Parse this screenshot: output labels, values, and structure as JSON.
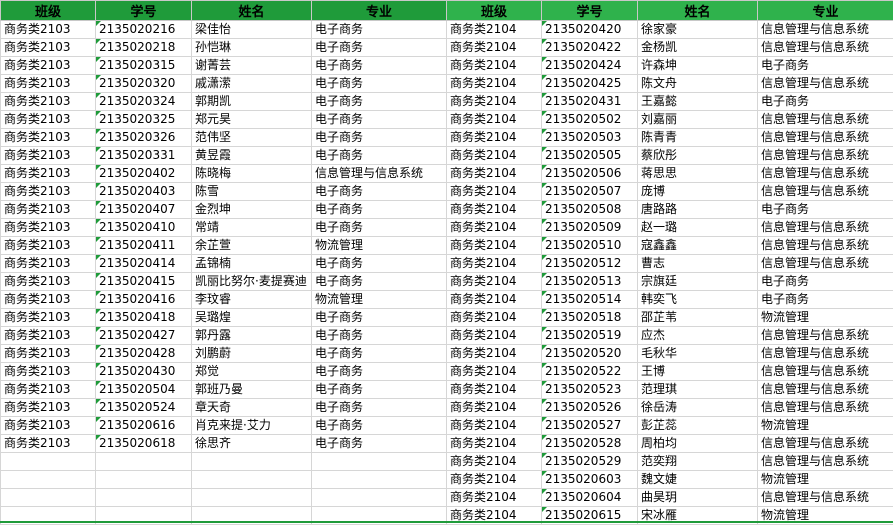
{
  "colors": {
    "header_left": "#1f9b3a",
    "header_right": "#2fb24c",
    "marker": "#1f9b3a"
  },
  "headers": [
    "班级",
    "学号",
    "姓名",
    "专业",
    "班级",
    "学号",
    "姓名",
    "专业"
  ],
  "left_rows": [
    [
      "商务类2103",
      "2135020216",
      "梁佳怡",
      "电子商务"
    ],
    [
      "商务类2103",
      "2135020218",
      "孙恺琳",
      "电子商务"
    ],
    [
      "商务类2103",
      "2135020315",
      "谢菁芸",
      "电子商务"
    ],
    [
      "商务类2103",
      "2135020320",
      "戚潇潆",
      "电子商务"
    ],
    [
      "商务类2103",
      "2135020324",
      "郭期凯",
      "电子商务"
    ],
    [
      "商务类2103",
      "2135020325",
      "郑元昊",
      "电子商务"
    ],
    [
      "商务类2103",
      "2135020326",
      "范伟坚",
      "电子商务"
    ],
    [
      "商务类2103",
      "2135020331",
      "黄昱霞",
      "电子商务"
    ],
    [
      "商务类2103",
      "2135020402",
      "陈晓梅",
      "信息管理与信息系统"
    ],
    [
      "商务类2103",
      "2135020403",
      "陈雪",
      "电子商务"
    ],
    [
      "商务类2103",
      "2135020407",
      "金烈坤",
      "电子商务"
    ],
    [
      "商务类2103",
      "2135020410",
      "常靖",
      "电子商务"
    ],
    [
      "商务类2103",
      "2135020411",
      "余芷萱",
      "物流管理"
    ],
    [
      "商务类2103",
      "2135020414",
      "孟锦楠",
      "电子商务"
    ],
    [
      "商务类2103",
      "2135020415",
      "凯丽比努尔·麦提赛迪",
      "电子商务"
    ],
    [
      "商务类2103",
      "2135020416",
      "李玟睿",
      "物流管理"
    ],
    [
      "商务类2103",
      "2135020418",
      "吴璐煌",
      "电子商务"
    ],
    [
      "商务类2103",
      "2135020427",
      "郭丹露",
      "电子商务"
    ],
    [
      "商务类2103",
      "2135020428",
      "刘鹏蔚",
      "电子商务"
    ],
    [
      "商务类2103",
      "2135020430",
      "郑觉",
      "电子商务"
    ],
    [
      "商务类2103",
      "2135020504",
      "郭班乃曼",
      "电子商务"
    ],
    [
      "商务类2103",
      "2135020524",
      "章天奇",
      "电子商务"
    ],
    [
      "商务类2103",
      "2135020616",
      "肖克来提·艾力",
      "电子商务"
    ],
    [
      "商务类2103",
      "2135020618",
      "徐思齐",
      "电子商务"
    ]
  ],
  "right_rows": [
    [
      "商务类2104",
      "2135020420",
      "徐家豪",
      "信息管理与信息系统"
    ],
    [
      "商务类2104",
      "2135020422",
      "金杨凯",
      "信息管理与信息系统"
    ],
    [
      "商务类2104",
      "2135020424",
      "许森坤",
      "电子商务"
    ],
    [
      "商务类2104",
      "2135020425",
      "陈文舟",
      "信息管理与信息系统"
    ],
    [
      "商务类2104",
      "2135020431",
      "王嘉懿",
      "电子商务"
    ],
    [
      "商务类2104",
      "2135020502",
      "刘嘉丽",
      "信息管理与信息系统"
    ],
    [
      "商务类2104",
      "2135020503",
      "陈青青",
      "信息管理与信息系统"
    ],
    [
      "商务类2104",
      "2135020505",
      "蔡欣彤",
      "信息管理与信息系统"
    ],
    [
      "商务类2104",
      "2135020506",
      "蒋思思",
      "信息管理与信息系统"
    ],
    [
      "商务类2104",
      "2135020507",
      "庞博",
      "信息管理与信息系统"
    ],
    [
      "商务类2104",
      "2135020508",
      "唐路路",
      "电子商务"
    ],
    [
      "商务类2104",
      "2135020509",
      "赵一璐",
      "信息管理与信息系统"
    ],
    [
      "商务类2104",
      "2135020510",
      "寇鑫鑫",
      "信息管理与信息系统"
    ],
    [
      "商务类2104",
      "2135020512",
      "曹志",
      "信息管理与信息系统"
    ],
    [
      "商务类2104",
      "2135020513",
      "宗旗廷",
      "电子商务"
    ],
    [
      "商务类2104",
      "2135020514",
      "韩奕飞",
      "电子商务"
    ],
    [
      "商务类2104",
      "2135020518",
      "邵芷苇",
      "物流管理"
    ],
    [
      "商务类2104",
      "2135020519",
      "应杰",
      "信息管理与信息系统"
    ],
    [
      "商务类2104",
      "2135020520",
      "毛秋华",
      "信息管理与信息系统"
    ],
    [
      "商务类2104",
      "2135020522",
      "王博",
      "信息管理与信息系统"
    ],
    [
      "商务类2104",
      "2135020523",
      "范理琪",
      "信息管理与信息系统"
    ],
    [
      "商务类2104",
      "2135020526",
      "徐岳涛",
      "信息管理与信息系统"
    ],
    [
      "商务类2104",
      "2135020527",
      "彭芷蕊",
      "物流管理"
    ],
    [
      "商务类2104",
      "2135020528",
      "周柏均",
      "信息管理与信息系统"
    ],
    [
      "商务类2104",
      "2135020529",
      "范奕翔",
      "信息管理与信息系统"
    ],
    [
      "商务类2104",
      "2135020603",
      "魏文婕",
      "物流管理"
    ],
    [
      "商务类2104",
      "2135020604",
      "曲昊玥",
      "信息管理与信息系统"
    ],
    [
      "商务类2104",
      "2135020615",
      "宋冰雁",
      "物流管理"
    ]
  ]
}
